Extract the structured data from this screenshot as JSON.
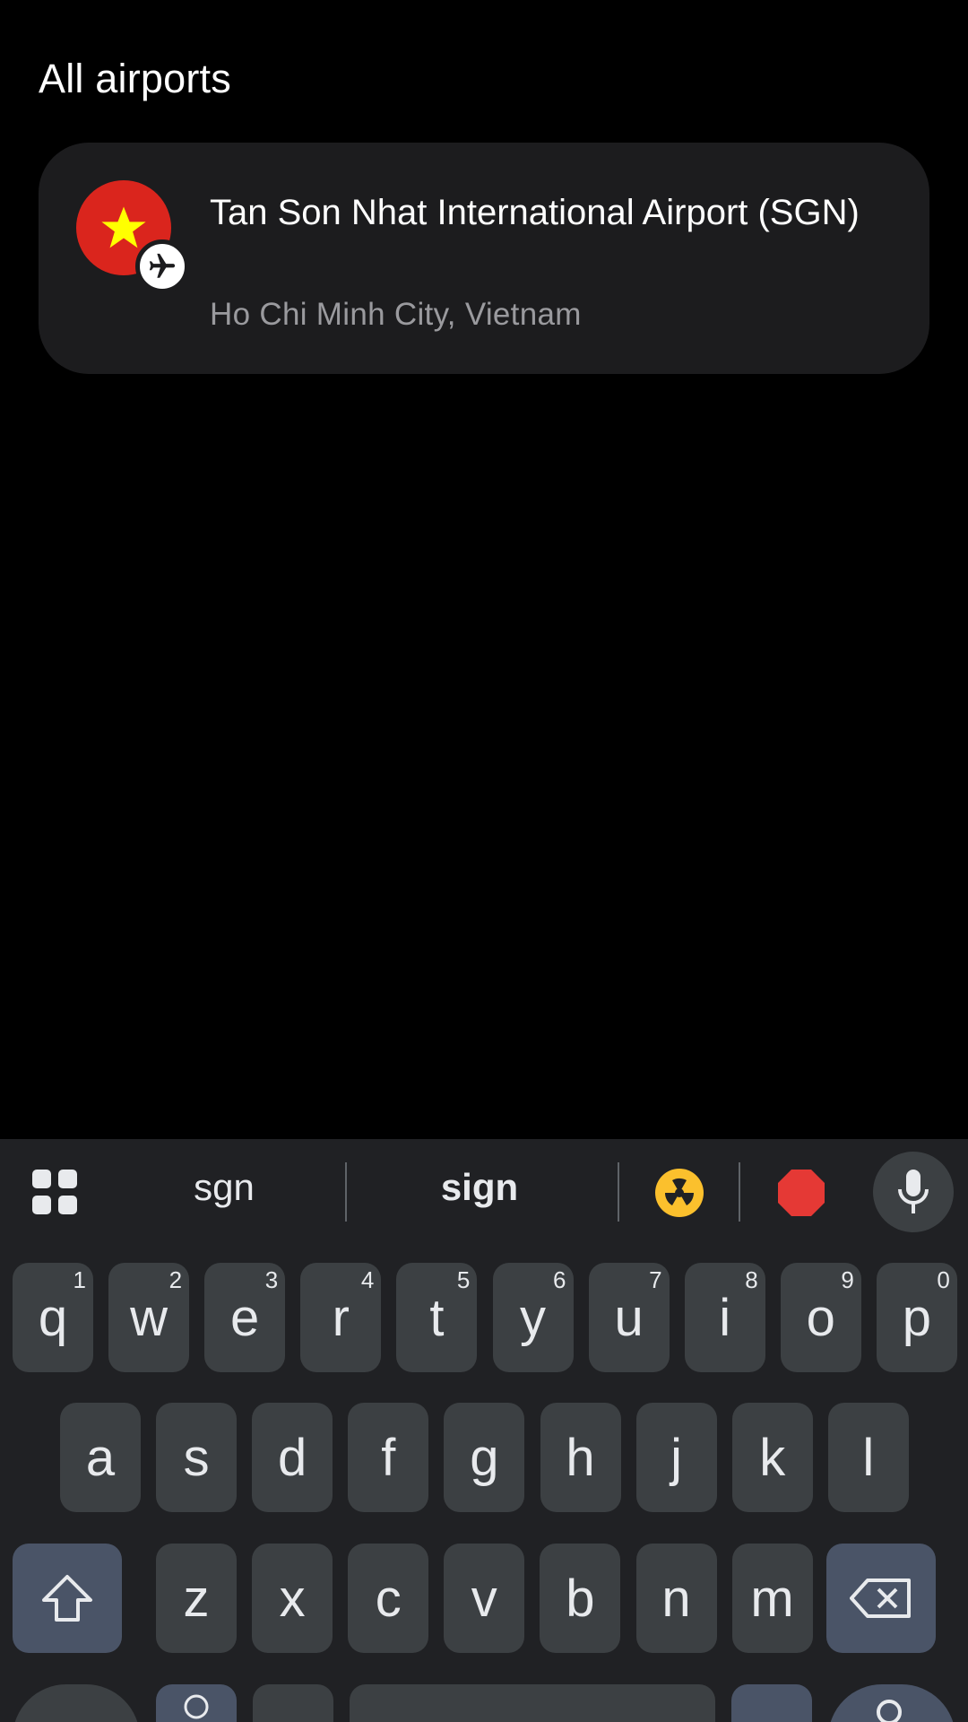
{
  "section": {
    "title": "All airports"
  },
  "airport": {
    "name": "Tan Son Nhat International Airport (SGN)",
    "location": "Ho Chi Minh City, Vietnam",
    "flag_icon": "vietnam-flag-icon",
    "badge_icon": "airplane-icon",
    "flag_color": "#da251d",
    "star_color": "#ffff00"
  },
  "keyboard": {
    "suggestions": [
      "sgn",
      "sign"
    ],
    "emoji_suggestions": [
      "☢️",
      "🛑"
    ],
    "row1": [
      {
        "key": "q",
        "hint": "1"
      },
      {
        "key": "w",
        "hint": "2"
      },
      {
        "key": "e",
        "hint": "3"
      },
      {
        "key": "r",
        "hint": "4"
      },
      {
        "key": "t",
        "hint": "5"
      },
      {
        "key": "y",
        "hint": "6"
      },
      {
        "key": "u",
        "hint": "7"
      },
      {
        "key": "i",
        "hint": "8"
      },
      {
        "key": "o",
        "hint": "9"
      },
      {
        "key": "p",
        "hint": "0"
      }
    ],
    "row2": [
      "a",
      "s",
      "d",
      "f",
      "g",
      "h",
      "j",
      "k",
      "l"
    ],
    "row3": [
      "z",
      "x",
      "c",
      "v",
      "b",
      "n",
      "m"
    ],
    "key_color": "#3c4043",
    "special_key_color": "#4a5467",
    "background_color": "#202124"
  }
}
